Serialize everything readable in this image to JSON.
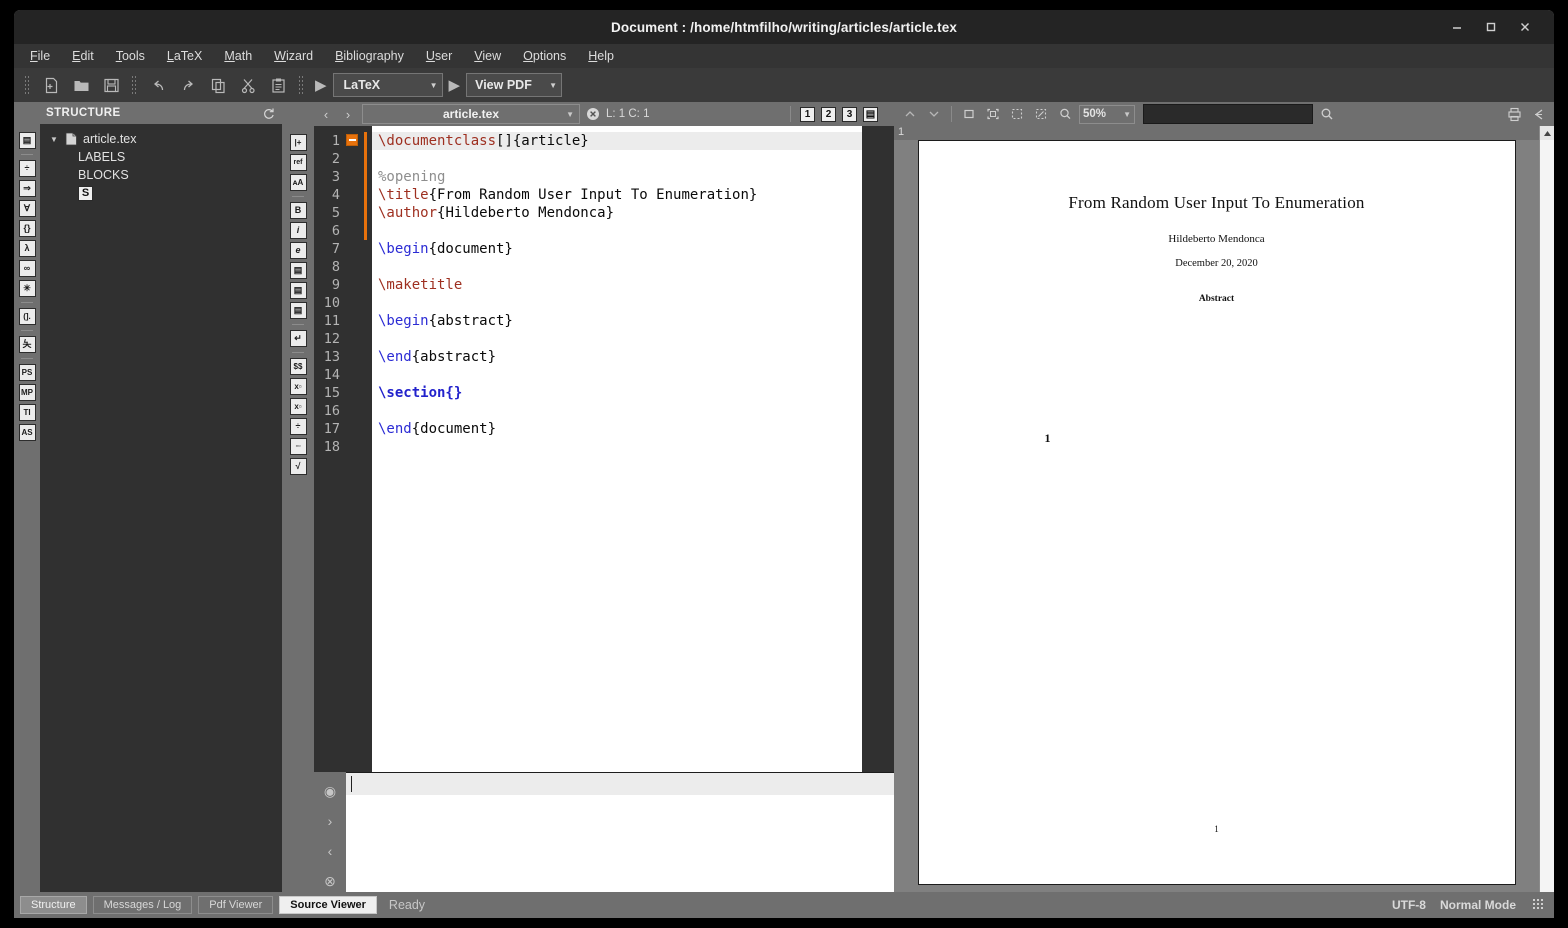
{
  "window": {
    "title": "Document : /home/htmfilho/writing/articles/article.tex",
    "minimize": "—",
    "maximize": "□",
    "close": "×"
  },
  "menubar": {
    "items": [
      {
        "label": "File",
        "mnemonic": "F",
        "rest": "ile"
      },
      {
        "label": "Edit",
        "mnemonic": "E",
        "rest": "dit"
      },
      {
        "label": "Tools",
        "mnemonic": "T",
        "rest": "ools"
      },
      {
        "label": "LaTeX",
        "mnemonic": "L",
        "rest": "aTeX"
      },
      {
        "label": "Math",
        "mnemonic": "M",
        "rest": "ath"
      },
      {
        "label": "Wizard",
        "mnemonic": "W",
        "rest": "izard"
      },
      {
        "label": "Bibliography",
        "mnemonic": "B",
        "rest": "ibliography"
      },
      {
        "label": "User",
        "mnemonic": "U",
        "rest": "ser"
      },
      {
        "label": "View",
        "mnemonic": "V",
        "rest": "iew"
      },
      {
        "label": "Options",
        "mnemonic": "O",
        "rest": "ptions"
      },
      {
        "label": "Help",
        "mnemonic": "H",
        "rest": "elp"
      }
    ]
  },
  "toolbar": {
    "icons": [
      "new-file-icon",
      "open-folder-icon",
      "save-icon",
      "undo-icon",
      "redo-icon",
      "copy-icon",
      "cut-icon",
      "paste-icon"
    ],
    "build_play": "▶",
    "build_profile": "LaTeX",
    "view_play": "▶",
    "view_target": "View PDF",
    "dropdown_arrow": "▼"
  },
  "structure": {
    "header": "STRUCTURE",
    "refresh_icon": "refresh-icon",
    "tree": {
      "expander": "▼",
      "root": "article.tex",
      "children": [
        "LABELS",
        "BLOCKS"
      ],
      "badge": "S"
    }
  },
  "left_rail": {
    "icons": [
      {
        "name": "structure-list-icon",
        "glyph": "▤"
      },
      {
        "name": "divide-operator-icon",
        "glyph": "÷"
      },
      {
        "name": "arrow-relation-icon",
        "glyph": "⇒"
      },
      {
        "name": "forall-icon",
        "glyph": "∀"
      },
      {
        "name": "delimiters-icon",
        "glyph": "{}"
      },
      {
        "name": "lambda-icon",
        "glyph": "λ"
      },
      {
        "name": "infinity-icon",
        "glyph": "∞"
      },
      {
        "name": "asterisk-operator-icon",
        "glyph": "✳"
      },
      {
        "name": "bracket-misc-icon",
        "glyph": "(]."
      },
      {
        "name": "stick-figure-icon",
        "glyph": "夨"
      },
      {
        "name": "postscript-icon",
        "glyph": "PS"
      },
      {
        "name": "metapost-icon",
        "glyph": "MP"
      },
      {
        "name": "tikz-icon",
        "glyph": "TI"
      },
      {
        "name": "asymptote-icon",
        "glyph": "AS"
      }
    ]
  },
  "format_rail": {
    "icons": [
      {
        "name": "insert-line-icon",
        "glyph": "|+"
      },
      {
        "name": "reference-icon",
        "glyph": "ref"
      },
      {
        "name": "font-size-icon",
        "glyph": "ᴀA"
      },
      {
        "name": "bold-icon",
        "glyph": "B"
      },
      {
        "name": "italic-icon",
        "glyph": "i"
      },
      {
        "name": "emphasis-icon",
        "glyph": "e"
      },
      {
        "name": "align-left-icon",
        "glyph": "▤"
      },
      {
        "name": "align-center-icon",
        "glyph": "▤"
      },
      {
        "name": "align-right-icon",
        "glyph": "▤"
      },
      {
        "name": "newline-icon",
        "glyph": "↵"
      },
      {
        "name": "math-mode-icon",
        "glyph": "$$"
      },
      {
        "name": "subscript-icon",
        "glyph": "x▫"
      },
      {
        "name": "superscript-icon",
        "glyph": "x▫"
      },
      {
        "name": "fraction-icon",
        "glyph": "÷"
      },
      {
        "name": "stacked-fraction-icon",
        "glyph": "▫▫"
      },
      {
        "name": "sqrt-icon",
        "glyph": "√"
      }
    ]
  },
  "editor": {
    "back_arrow": "‹",
    "forward_arrow": "›",
    "file_tab": "article.tex",
    "dropdown_arrow": "▼",
    "close_icon": "close-icon",
    "cursor_position": "L: 1 C: 1",
    "bookmark_buttons": [
      "1",
      "2",
      "3"
    ],
    "list_icon": "bookmark-list-icon",
    "line_numbers": [
      "1",
      "2",
      "3",
      "4",
      "5",
      "6",
      "7",
      "8",
      "9",
      "10",
      "11",
      "12",
      "13",
      "14",
      "15",
      "16",
      "17",
      "18"
    ],
    "fold_marker": "−",
    "lines": [
      {
        "n": 1,
        "current": true,
        "tokens": [
          {
            "t": "cmd",
            "v": "\\documentclass"
          },
          {
            "t": "txt",
            "v": "[]{article}"
          }
        ]
      },
      {
        "n": 2,
        "current": false,
        "tokens": []
      },
      {
        "n": 3,
        "current": false,
        "tokens": [
          {
            "t": "cmt",
            "v": "%opening"
          }
        ]
      },
      {
        "n": 4,
        "current": false,
        "tokens": [
          {
            "t": "cmd",
            "v": "\\title"
          },
          {
            "t": "txt",
            "v": "{From Random User Input To Enumeration}"
          }
        ]
      },
      {
        "n": 5,
        "current": false,
        "tokens": [
          {
            "t": "cmd",
            "v": "\\author"
          },
          {
            "t": "txt",
            "v": "{Hildeberto Mendonca}"
          }
        ]
      },
      {
        "n": 6,
        "current": false,
        "tokens": []
      },
      {
        "n": 7,
        "current": false,
        "tokens": [
          {
            "t": "env",
            "v": "\\begin"
          },
          {
            "t": "txt",
            "v": "{document}"
          }
        ]
      },
      {
        "n": 8,
        "current": false,
        "tokens": []
      },
      {
        "n": 9,
        "current": false,
        "tokens": [
          {
            "t": "cmd",
            "v": "\\maketitle"
          }
        ]
      },
      {
        "n": 10,
        "current": false,
        "tokens": []
      },
      {
        "n": 11,
        "current": false,
        "tokens": [
          {
            "t": "env",
            "v": "\\begin"
          },
          {
            "t": "txt",
            "v": "{abstract}"
          }
        ]
      },
      {
        "n": 12,
        "current": false,
        "tokens": []
      },
      {
        "n": 13,
        "current": false,
        "tokens": [
          {
            "t": "env",
            "v": "\\end"
          },
          {
            "t": "txt",
            "v": "{abstract}"
          }
        ]
      },
      {
        "n": 14,
        "current": false,
        "tokens": []
      },
      {
        "n": 15,
        "current": false,
        "tokens": [
          {
            "t": "sec",
            "v": "\\section{}"
          }
        ]
      },
      {
        "n": 16,
        "current": false,
        "tokens": []
      },
      {
        "n": 17,
        "current": false,
        "tokens": [
          {
            "t": "env",
            "v": "\\end"
          },
          {
            "t": "txt",
            "v": "{document}"
          }
        ]
      },
      {
        "n": 18,
        "current": false,
        "tokens": []
      }
    ]
  },
  "source_viewer": {
    "rail_icons": [
      {
        "name": "preview-eye-icon",
        "glyph": "◉"
      },
      {
        "name": "next-icon",
        "glyph": "›"
      },
      {
        "name": "previous-icon",
        "glyph": "‹"
      },
      {
        "name": "clear-icon",
        "glyph": "⊗"
      }
    ],
    "content": ""
  },
  "pdf_viewer": {
    "toolbar": {
      "prev_page_icon": "chevron-up-icon",
      "next_page_icon": "chevron-down-icon",
      "fit_width_icon": "fit-width-icon",
      "fit_page_icon": "fit-page-icon",
      "select-tool_icon": "marquee-select-icon",
      "zoom_region_icon": "zoom-region-icon",
      "magnifier_icon": "magnifier-icon",
      "zoom_level": "50%",
      "dropdown_arrow": "▼",
      "search_placeholder": "",
      "search_icon": "search-icon",
      "print_icon": "print-icon",
      "collapse_icon": "collapse-panel-icon"
    },
    "page_label": "1",
    "document": {
      "title": "From Random User Input To Enumeration",
      "author": "Hildeberto Mendonca",
      "date": "December 20, 2020",
      "abstract_heading": "Abstract",
      "section_number": "1",
      "page_number": "1"
    }
  },
  "statusbar": {
    "buttons": [
      {
        "label": "Structure",
        "state": "pressed"
      },
      {
        "label": "Messages / Log",
        "state": "normal"
      },
      {
        "label": "Pdf Viewer",
        "state": "normal"
      },
      {
        "label": "Source Viewer",
        "state": "active"
      }
    ],
    "status": "Ready",
    "encoding": "UTF-8",
    "mode": "Normal Mode"
  }
}
